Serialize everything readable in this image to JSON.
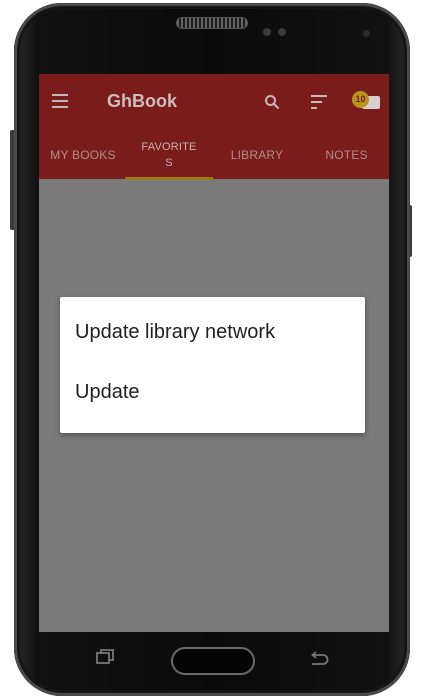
{
  "app": {
    "title": "GhBook",
    "notification_count": "10"
  },
  "toolbar": {
    "icons": [
      "menu-icon",
      "search-icon",
      "sort-icon",
      "mail-icon"
    ]
  },
  "tabs": [
    {
      "label": "MY BOOKS"
    },
    {
      "label": "FAVORITE\nS",
      "selected": true
    },
    {
      "label": "LIBRARY"
    },
    {
      "label": "NOTES"
    }
  ],
  "dialog": {
    "items": [
      {
        "label": "Update library network"
      },
      {
        "label": "Update"
      }
    ]
  },
  "device_buttons": [
    "recent-apps-icon",
    "home-button",
    "back-icon"
  ],
  "colors": {
    "appbar": "#7a1c1c",
    "scrim": "#7a7a7a",
    "tab_indicator": "#9a7a14",
    "dialog_bg": "#ffffff"
  }
}
